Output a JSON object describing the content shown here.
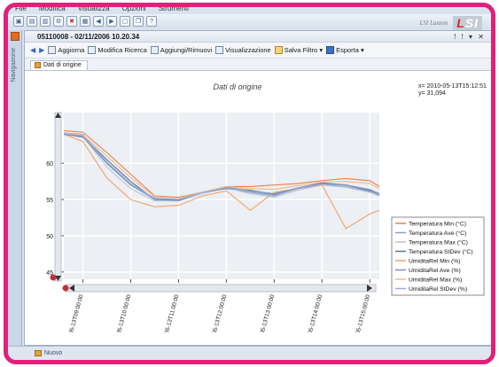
{
  "menubar": [
    "File",
    "Modifica",
    "Visualizza",
    "Opzioni",
    "Strumenti"
  ],
  "brand": {
    "subtitle": "LSI Lastem",
    "logo": "LSI"
  },
  "toolbar_icons": [
    "open-icon",
    "save-icon",
    "save-as-icon",
    "settings-icon",
    "clear-icon",
    "grid-icon",
    "prev-icon",
    "next-icon",
    "window-icon",
    "copy-icon",
    "help-icon"
  ],
  "navigation": {
    "label": "Navigazione"
  },
  "document": {
    "title": "05110008 - 02/11/2006 10.20.34",
    "window_controls": "! !  ▾ ✕"
  },
  "toolbar": {
    "items": [
      {
        "label": "Aggiorna",
        "icon": "refresh-icon"
      },
      {
        "label": "Modifica Ricerca",
        "icon": "edit-search-icon"
      },
      {
        "label": "Aggiungi/Rimuovi",
        "icon": "add-remove-icon"
      },
      {
        "label": "Visualizzazione",
        "icon": "view-icon"
      },
      {
        "label": "Salva Filtro ▾",
        "icon": "save-filter-icon"
      },
      {
        "label": "Esporta ▾",
        "icon": "export-icon"
      }
    ]
  },
  "tab": {
    "label": "Dati di origine"
  },
  "statusbar": {
    "tab_label": "Nuovo"
  },
  "cursor_readout": {
    "x": "x= 2010-05-13T15:12:51",
    "y": "y= 31,094"
  },
  "chart_data": {
    "type": "line",
    "title": "Dati di origine",
    "x": [
      "2010-05-13T09:00:00",
      "2010-05-13T10:00:00",
      "2010-05-13T11:00:00",
      "2010-05-13T12:00:00",
      "2010-05-13T13:00:00",
      "2010-05-13T14:00:00",
      "2010-05-13T15:00:00"
    ],
    "x_numeric_hours": [
      8.6,
      9.0,
      9.5,
      10.0,
      10.5,
      11.0,
      11.5,
      12.0,
      12.5,
      13.0,
      13.5,
      14.0,
      14.5,
      15.0,
      15.2
    ],
    "ylim": [
      44,
      67
    ],
    "yticks": [
      45,
      50,
      55,
      60
    ],
    "grid": true,
    "legend_position": "right",
    "series": [
      {
        "name": "Temperatura Min (°C)",
        "color": "#e8804a",
        "values": [
          64.5,
          64.3,
          61.5,
          58.5,
          55.5,
          55.3,
          56.0,
          56.8,
          56.8,
          57.0,
          57.2,
          57.6,
          57.9,
          57.6,
          56.8
        ]
      },
      {
        "name": "Temperatura Ave (°C)",
        "color": "#8aa0c8",
        "values": [
          64.2,
          64.0,
          60.0,
          57.0,
          55.0,
          55.0,
          56.0,
          56.6,
          56.0,
          55.5,
          56.5,
          57.2,
          57.0,
          56.4,
          55.8
        ]
      },
      {
        "name": "Temperatura Max (°C)",
        "color": "#b7c4da",
        "values": [
          64.0,
          63.8,
          59.5,
          56.5,
          54.8,
          54.8,
          55.8,
          56.6,
          55.8,
          55.3,
          56.3,
          57.0,
          56.7,
          56.0,
          55.5
        ]
      },
      {
        "name": "Temperatura StDev (°C)",
        "color": "#5a73a8",
        "values": [
          64.0,
          63.7,
          60.5,
          57.5,
          55.0,
          54.9,
          56.0,
          56.5,
          56.3,
          55.7,
          56.6,
          57.3,
          57.0,
          56.2,
          55.6
        ]
      },
      {
        "name": "UmiditaRel Min (%)",
        "color": "#f0a36a",
        "values": [
          64.0,
          63.0,
          58.0,
          55.0,
          54.0,
          54.2,
          55.5,
          56.2,
          53.5,
          56.0,
          56.5,
          57.0,
          51.0,
          53.0,
          53.5
        ]
      },
      {
        "name": "UmiditaRel Ave (%)",
        "color": "#7e8fb8",
        "values": [
          64.0,
          63.6,
          60.0,
          57.0,
          55.2,
          55.0,
          56.0,
          56.7,
          56.2,
          55.8,
          56.6,
          57.2,
          57.0,
          56.3,
          55.7
        ]
      },
      {
        "name": "UmiditaRel Max (%)",
        "color": "#f2b98c",
        "values": [
          64.2,
          63.9,
          61.0,
          58.0,
          55.4,
          55.2,
          56.0,
          56.8,
          56.5,
          56.4,
          56.9,
          57.4,
          57.5,
          57.2,
          56.5
        ]
      },
      {
        "name": "UmiditaRel StDev (%)",
        "color": "#9bb0d4",
        "values": [
          64.1,
          63.8,
          60.2,
          57.2,
          55.1,
          55.0,
          56.0,
          56.6,
          56.1,
          55.6,
          56.5,
          57.1,
          56.8,
          56.1,
          55.6
        ]
      }
    ]
  }
}
